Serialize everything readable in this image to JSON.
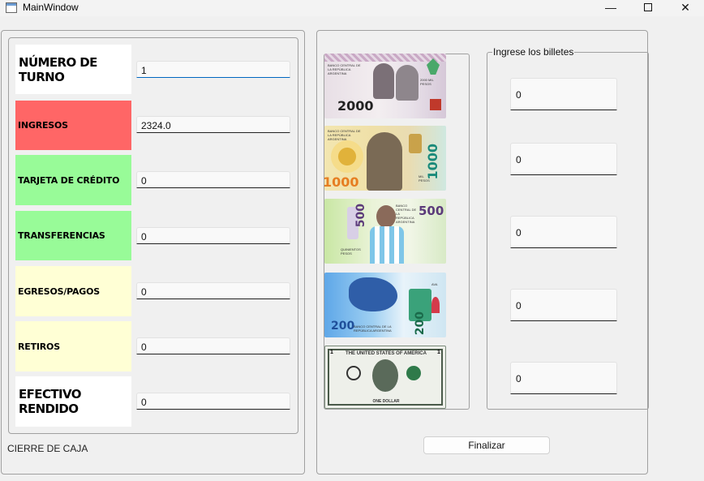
{
  "window": {
    "title": "MainWindow",
    "minimize_symbol": "—",
    "close_symbol": "✕"
  },
  "form": {
    "rows": [
      {
        "label": "NÚMERO DE TURNO",
        "value": "1",
        "color": "#ffffff"
      },
      {
        "label": "INGRESOS",
        "value": "2324.0",
        "color": "#ff6666"
      },
      {
        "label": "TARJETA DE CRÉDITO",
        "value": "0",
        "color": "#98fb98"
      },
      {
        "label": "TRANSFERENCIAS",
        "value": "0",
        "color": "#98fb98"
      },
      {
        "label": "EGRESOS/PAGOS",
        "value": "0",
        "color": "#ffffd5"
      },
      {
        "label": "RETIROS",
        "value": "0",
        "color": "#ffffd5"
      },
      {
        "label": "EFECTIVO RENDIDO",
        "value": "0",
        "color": "#ffffff"
      }
    ],
    "footer_label": "CIERRE DE CAJA"
  },
  "bills": {
    "items": [
      {
        "denomination": "2000",
        "icon": "bill-2000-image",
        "caption": "BANCO CENTRAL DE LA REPÚBLICA ARGENTINA",
        "side_text": "2000 MIL PESOS"
      },
      {
        "denomination": "1000",
        "icon": "bill-1000-image",
        "caption": "BANCO CENTRAL DE LA REPÚBLICA ARGENTINA",
        "side_text": "MIL PESOS"
      },
      {
        "denomination": "500",
        "icon": "bill-500-image",
        "caption": "BANCO CENTRAL DE LA REPÚBLICA ARGENTINA",
        "side_text": "QUINIENTOS PESOS"
      },
      {
        "denomination": "200",
        "icon": "bill-200-image",
        "caption": "BANCO CENTRAL DE LA REPÚBLICA ARGENTINA",
        "side_text": "AVA"
      },
      {
        "denomination": "1",
        "icon": "bill-one-dollar-image",
        "caption": "THE UNITED STATES OF AMERICA",
        "side_text": "ONE DOLLAR"
      }
    ],
    "group_title": "Ingrese los billetes",
    "counts": [
      "0",
      "0",
      "0",
      "0",
      "0"
    ]
  },
  "actions": {
    "finalize_label": "Finalizar"
  }
}
